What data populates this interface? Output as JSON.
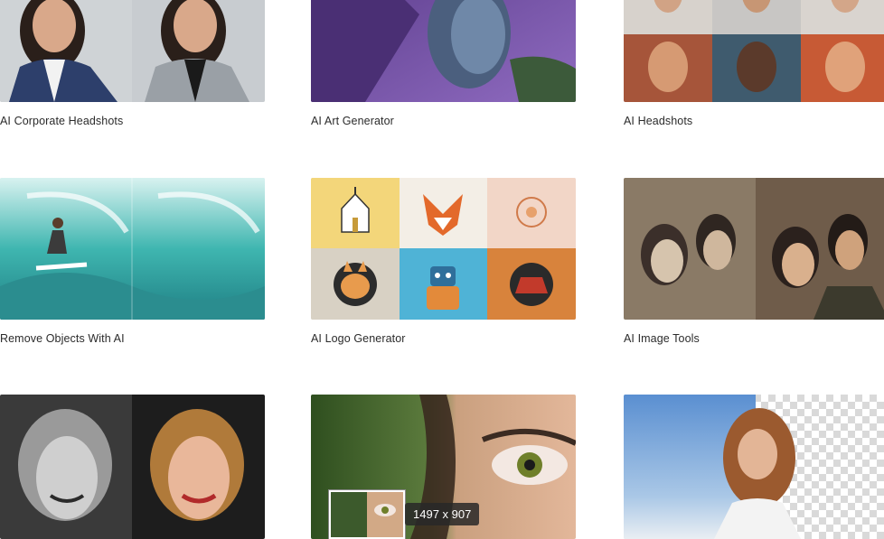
{
  "cards": [
    {
      "label": "AI Corporate Headshots"
    },
    {
      "label": "AI Art Generator"
    },
    {
      "label": "AI Headshots"
    },
    {
      "label": "Remove Objects With AI"
    },
    {
      "label": "AI Logo Generator"
    },
    {
      "label": "AI Image Tools"
    },
    {
      "label": ""
    },
    {
      "label": ""
    },
    {
      "label": ""
    }
  ],
  "preview": {
    "size_text": "1497 x 907"
  }
}
